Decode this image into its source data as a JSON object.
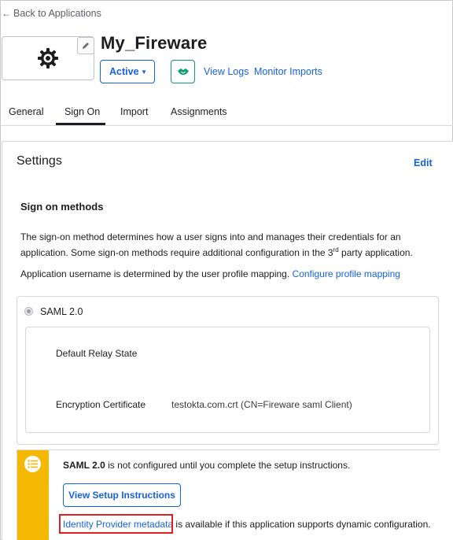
{
  "header": {
    "back_label": "Back to Applications",
    "app_title": "My_Fireware",
    "status": "Active",
    "view_logs": "View Logs",
    "monitor_imports": "Monitor Imports"
  },
  "tabs": [
    {
      "label": "General",
      "active": false
    },
    {
      "label": "Sign On",
      "active": true
    },
    {
      "label": "Import",
      "active": false
    },
    {
      "label": "Assignments",
      "active": false
    }
  ],
  "settings": {
    "title": "Settings",
    "edit_label": "Edit",
    "section_title": "Sign on methods",
    "description_part1": "The sign-on method determines how a user signs into and manages their credentials for an application. Some sign-on methods require additional configuration in the 3",
    "description_sup": "rd",
    "description_part2": " party application.",
    "username_text": "Application username is determined by the user profile mapping.",
    "username_link": "Configure profile mapping"
  },
  "method": {
    "label": "SAML 2.0",
    "fields": [
      {
        "label": "Default Relay State",
        "value": ""
      },
      {
        "label": "Encryption Certificate",
        "value": "testokta.com.crt (CN=Fireware saml Client)"
      }
    ]
  },
  "callout": {
    "bold": "SAML 2.0",
    "text": " is not configured until you complete the setup instructions.",
    "button_label": "View Setup Instructions",
    "idp_link": "Identity Provider metadata",
    "idp_text": " is available if this application supports dynamic configuration."
  },
  "colors": {
    "link": "#1662dd",
    "callout_bar": "#f5b800",
    "push_icon": "#0e9f6e",
    "highlight": "#e02020"
  }
}
